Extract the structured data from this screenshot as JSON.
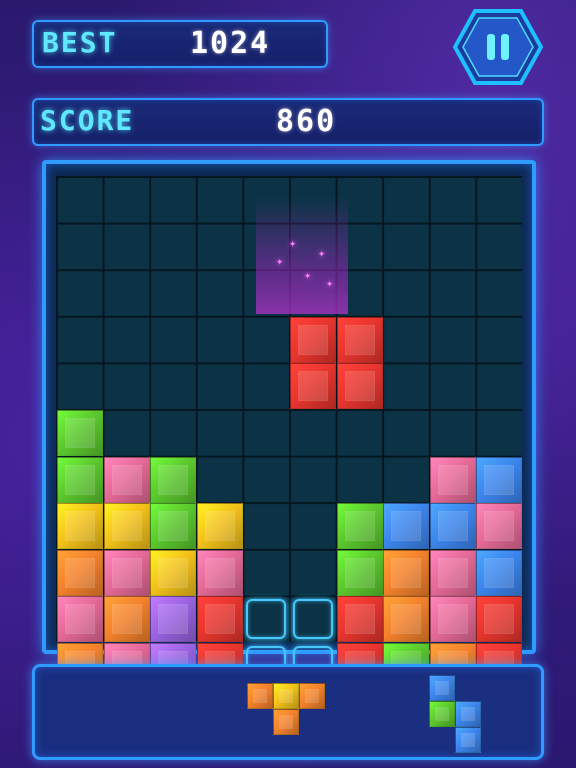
{
  "hud": {
    "best_label": "BEST",
    "best_value": "1024",
    "score_label": "SCORE",
    "score_value": "860"
  },
  "colors": {
    "G": "#5cc92e",
    "P": "#e66a97",
    "Y": "#f4c21a",
    "O": "#f5822c",
    "R": "#e8352e",
    "B": "#3d86ee",
    "V": "#9b63e2",
    "accent": "#2f9bff",
    "label": "#5fe8ff"
  },
  "board": {
    "rows": [
      "..........",
      "..........",
      "..........",
      ".....RR...",
      ".....RR...",
      "G.........",
      "GPG.....PB",
      "YYGY..GBBP",
      "OPYP..GOPB",
      "POVR..ROPR",
      "OPVR..RGOR"
    ],
    "active_piece": "R",
    "ghost_cells": [
      [
        9,
        4
      ],
      [
        9,
        5
      ],
      [
        10,
        4
      ],
      [
        10,
        5
      ]
    ]
  },
  "next_pieces": [
    {
      "name": "t-piece",
      "cells": [
        [
          "O",
          "Y",
          "O"
        ],
        [
          ".",
          "O",
          "."
        ]
      ]
    },
    {
      "name": "s-piece",
      "cells": [
        [
          "B",
          "."
        ],
        [
          "G",
          "B"
        ],
        [
          ".",
          "B"
        ]
      ]
    }
  ]
}
